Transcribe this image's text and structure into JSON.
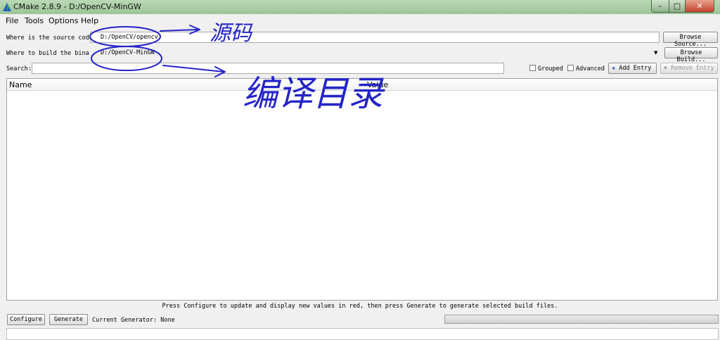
{
  "window": {
    "title": "CMake 2.8.9 - D:/OpenCV-MinGW"
  },
  "menu": {
    "items": [
      "File",
      "Tools",
      "Options",
      "Help"
    ]
  },
  "paths": {
    "source_label": "Where is the source code:",
    "source_value": "D:/OpenCV/opencv",
    "browse_source": "Browse Source...",
    "build_label": "Where to build the binaries:",
    "build_value": "D:/OpenCV-MinGW",
    "browse_build": "Browse Build..."
  },
  "search": {
    "label": "Search:",
    "value": ""
  },
  "options": {
    "grouped": "Grouped",
    "advanced": "Advanced",
    "add_entry": "Add Entry",
    "remove_entry": "Remove Entry"
  },
  "table": {
    "columns": [
      "Name",
      "Value"
    ]
  },
  "status": {
    "message": "Press Configure to update and display new values in red, then press Generate to generate selected build files."
  },
  "actions": {
    "configure": "Configure",
    "generate": "Generate",
    "generator_label": "Current Generator: None"
  },
  "annotations": {
    "source_note": "源码",
    "build_note": "编译目录"
  },
  "colors": {
    "annotation_ink": "#2424c8",
    "window_frame": "#9cc497",
    "close_button": "#c4402a"
  }
}
